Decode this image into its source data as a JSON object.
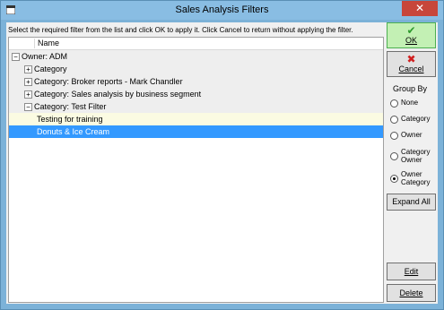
{
  "window": {
    "title": "Sales Analysis Filters",
    "close_glyph": "✕"
  },
  "instruction": "Select the required filter from the list and click OK to apply it. Click Cancel to return without applying the filter.",
  "tree": {
    "column_header": "Name",
    "rows": [
      {
        "expander": "−",
        "label": "Owner: ADM"
      },
      {
        "expander": "+",
        "label": "Category"
      },
      {
        "expander": "+",
        "label": "Category: Broker reports - Mark Chandler"
      },
      {
        "expander": "+",
        "label": "Category: Sales analysis by business segment"
      },
      {
        "expander": "−",
        "label": "Category: Test Filter"
      },
      {
        "expander": "",
        "label": "Testing for training"
      },
      {
        "expander": "",
        "label": "Donuts & Ice Cream"
      }
    ],
    "selected_row": "Donuts & Ice Cream"
  },
  "buttons": {
    "ok": "OK",
    "cancel": "Cancel",
    "expand_all": "Expand All",
    "edit": "Edit",
    "delete": "Delete"
  },
  "group_by": {
    "title": "Group By",
    "options": [
      "None",
      "Category",
      "Owner",
      "Category Owner",
      "Owner Category"
    ],
    "selected": "Owner Category"
  },
  "colors": {
    "selection": "#3399ff",
    "ok_button": "#c3f0b4",
    "close_button": "#c7463a",
    "titlebar": "#89bde3"
  }
}
